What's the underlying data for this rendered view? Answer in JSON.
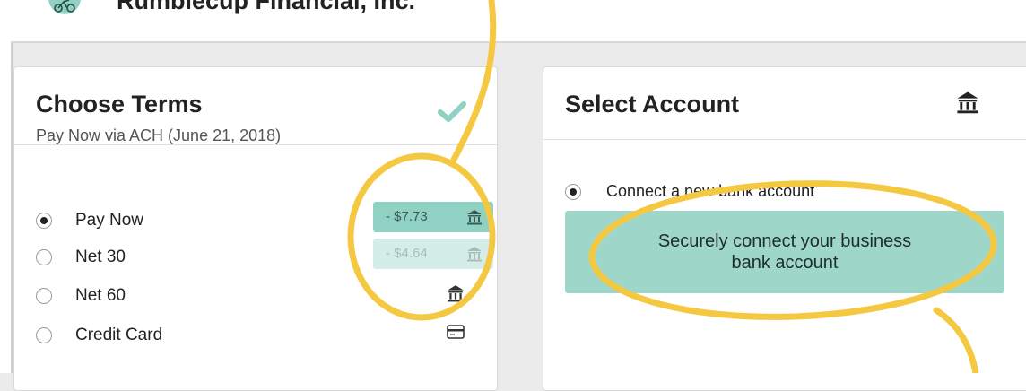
{
  "header": {
    "company_name": "Rumblecup Financial, Inc."
  },
  "terms_card": {
    "title": "Choose Terms",
    "subtitle": "Pay Now via ACH (June 21, 2018)",
    "options": [
      {
        "label": "Pay Now",
        "selected": true,
        "price": "- $7.73",
        "icon": "bank-icon"
      },
      {
        "label": "Net 30",
        "selected": false,
        "price": "- $4.64",
        "icon": "bank-icon"
      },
      {
        "label": "Net 60",
        "selected": false,
        "price": "",
        "icon": "bank-icon"
      },
      {
        "label": "Credit Card",
        "selected": false,
        "price": "",
        "icon": "credit-card-icon"
      }
    ]
  },
  "account_card": {
    "title": "Select Account",
    "option_label": "Connect a new bank account",
    "connect_button": "Securely connect your business\nbank account"
  },
  "colors": {
    "accent": "#8fd1c2",
    "accent_light": "#d4ede7",
    "button": "#9ed6ca",
    "annotation": "#f5c842"
  }
}
